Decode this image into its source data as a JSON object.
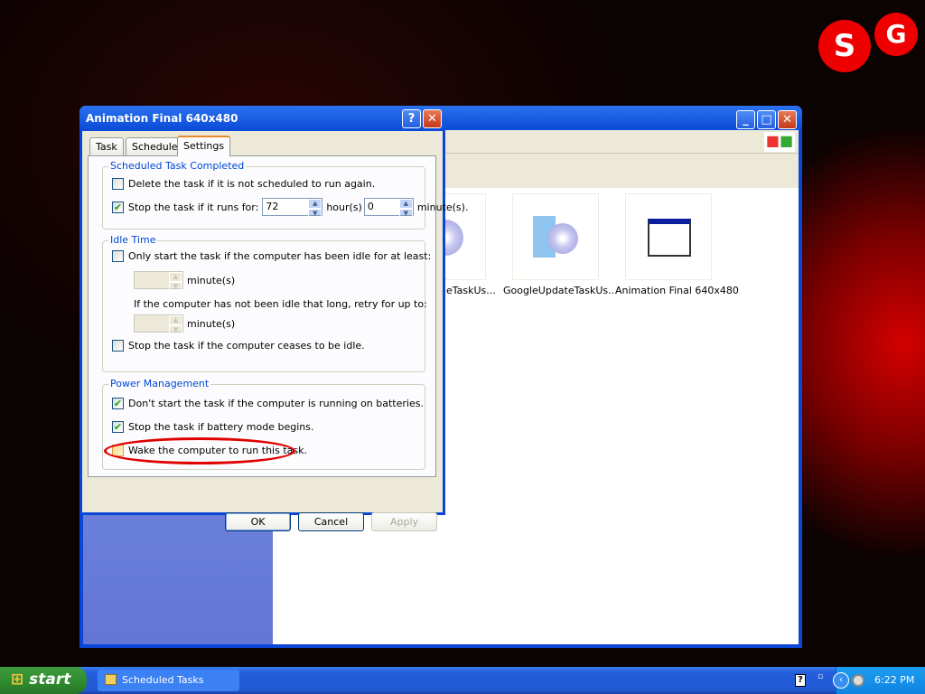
{
  "logo": {
    "text": "SG"
  },
  "explorer": {
    "items": [
      {
        "label": "eTaskUs...",
        "icon": "package-cd-icon"
      },
      {
        "label": "GoogleUpdateTaskUs...",
        "icon": "package-cd-icon"
      },
      {
        "label": "Animation Final 640x480",
        "icon": "window-app-icon"
      }
    ]
  },
  "dialog": {
    "title": "Animation Final 640x480",
    "help": "?",
    "close": "✕",
    "tabs": [
      "Task",
      "Schedule",
      "Settings"
    ],
    "active_tab": "Settings",
    "completed": {
      "label": "Scheduled Task Completed",
      "delete": {
        "label": "Delete the task if it is not scheduled to run again.",
        "checked": false
      },
      "stop": {
        "label": "Stop the task if it runs for:",
        "checked": true,
        "hours": "72",
        "hours_label": "hour(s)",
        "minutes": "0",
        "minutes_label": "minute(s)."
      }
    },
    "idle": {
      "label": "Idle Time",
      "only": {
        "label": "Only start the task if the computer has been idle for at least:",
        "checked": false
      },
      "minutes_label1": "minute(s)",
      "retry_label": "If the computer has not been idle that long, retry for up to:",
      "minutes_label2": "minute(s)",
      "cease": {
        "label": "Stop the task if the computer ceases to be idle.",
        "checked": false
      }
    },
    "power": {
      "label": "Power Management",
      "batteries": {
        "label": "Don't start the task if the computer is running on batteries.",
        "checked": true
      },
      "battery_mode": {
        "label": "Stop the task if battery mode begins.",
        "checked": true
      },
      "wake": {
        "label": "Wake the computer to run this task.",
        "checked": false,
        "highlight_color": "#e00000"
      }
    },
    "buttons": {
      "ok": "OK",
      "cancel": "Cancel",
      "apply": "Apply"
    }
  },
  "taskbar": {
    "start": "start",
    "task": "Scheduled Tasks",
    "clock": "6:22 PM"
  }
}
